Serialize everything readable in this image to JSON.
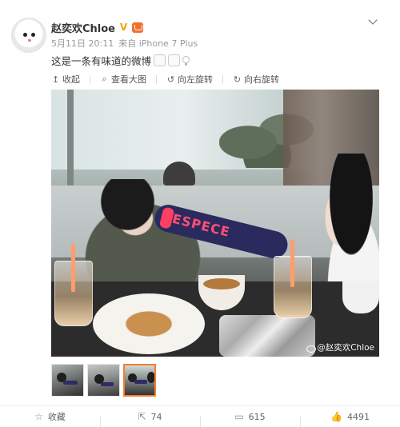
{
  "post": {
    "username": "赵奕欢Chloe",
    "time": "5月11日 20:11",
    "source": "来自 iPhone 7 Plus",
    "text": "这是一条有味道的微博",
    "watermark": "@赵奕欢Chloe"
  },
  "toolbar": {
    "collapse": "收起",
    "view_large": "查看大图",
    "rotate_left": "向左旋转",
    "rotate_right": "向右旋转"
  },
  "footer": {
    "favorite": "收藏",
    "repost_count": "74",
    "comment_count": "615",
    "like_count": "4491"
  },
  "icons": {
    "verified": "v-badge-icon",
    "member": "member-crown-icon",
    "collapse": "arrow-up-icon",
    "view_large": "magnifier-icon",
    "rotate_left": "rotate-left-icon",
    "rotate_right": "rotate-right-icon",
    "favorite": "star-icon",
    "repost": "repost-icon",
    "comment": "comment-icon",
    "like": "thumbs-up-icon"
  },
  "colors": {
    "accent_orange": "#f97c2c",
    "verified_gold": "#f5a300",
    "text_main": "#333333",
    "text_meta": "#999999"
  },
  "photo": {
    "shirt_text": "ESPECE"
  }
}
